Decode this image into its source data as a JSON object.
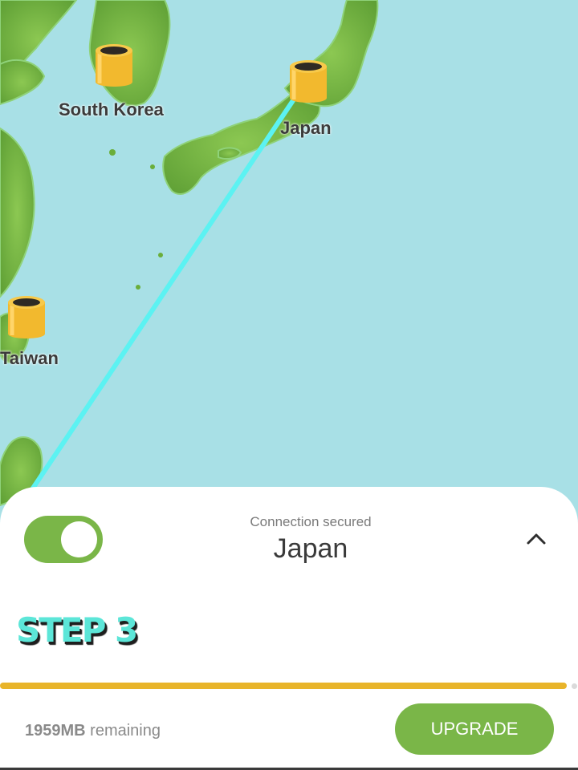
{
  "map": {
    "countries": [
      {
        "label": "South Korea"
      },
      {
        "label": "Japan"
      },
      {
        "label": "Taiwan"
      }
    ],
    "connected_to": "Japan"
  },
  "connection": {
    "enabled": true,
    "status": "Connection secured",
    "server": "Japan"
  },
  "step": {
    "label": "STEP 3"
  },
  "data_usage": {
    "amount": "1959MB",
    "suffix": "remaining",
    "progress_fraction": 0.98
  },
  "actions": {
    "upgrade_label": "UPGRADE"
  },
  "colors": {
    "ocean": "#a8e0e6",
    "land": "#6aae3a",
    "accent_green": "#7ab648",
    "route_line": "#5cf2f2",
    "progress": "#e8b42a",
    "step_text": "#5ce6d8"
  }
}
